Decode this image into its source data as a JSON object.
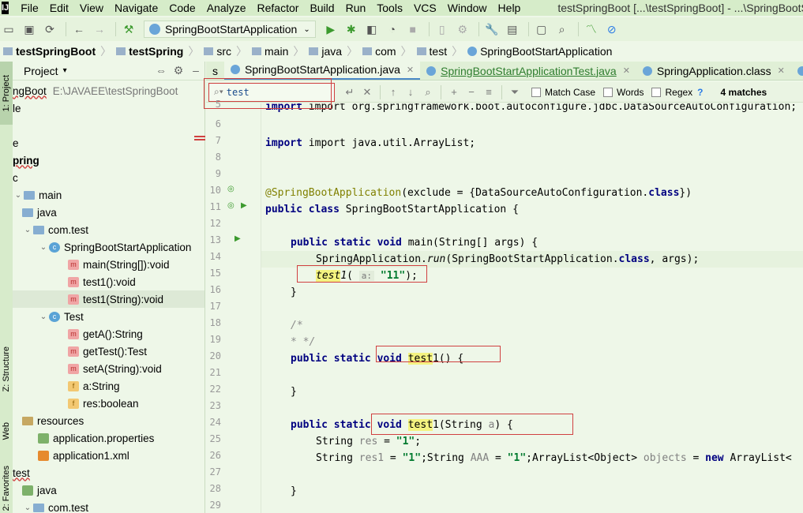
{
  "app": {
    "logo": "IJ",
    "window_title": "testSpringBoot [...\\testSpringBoot] - ...\\SpringBootStartA",
    "menus": [
      "File",
      "Edit",
      "View",
      "Navigate",
      "Code",
      "Analyze",
      "Refactor",
      "Build",
      "Run",
      "Tools",
      "VCS",
      "Window",
      "Help"
    ]
  },
  "toolbar": {
    "run_config": "SpringBootStartApplication"
  },
  "breadcrumb": [
    "testSpringBoot",
    "testSpring",
    "src",
    "main",
    "java",
    "com",
    "test",
    "SpringBootStartApplication"
  ],
  "left_stripe": {
    "project_tab": "1: Project",
    "structure_tab": "Z: Structure",
    "web_tab": "Web",
    "favorites_tab": "2: Favorites"
  },
  "project_panel": {
    "title": "Project",
    "rows": [
      {
        "text": "ngBoot",
        "extra": "E:\\JAVAEE\\testSpringBoot"
      },
      {
        "text": "le"
      },
      {
        "text": "e"
      },
      {
        "text": "pring"
      },
      {
        "text": "c"
      },
      {
        "text": "main"
      },
      {
        "text": "java"
      },
      {
        "text": "com.test"
      },
      {
        "text": "SpringBootStartApplication"
      },
      {
        "text": "main(String[]):void"
      },
      {
        "text": "test1():void"
      },
      {
        "text": "test1(String):void"
      },
      {
        "text": "Test"
      },
      {
        "text": "getA():String"
      },
      {
        "text": "getTest():Test"
      },
      {
        "text": "setA(String):void"
      },
      {
        "text": "a:String"
      },
      {
        "text": "res:boolean"
      },
      {
        "text": "resources"
      },
      {
        "text": "application.properties"
      },
      {
        "text": "application1.xml"
      },
      {
        "text": "test"
      },
      {
        "text": "java"
      },
      {
        "text": "com.test"
      }
    ]
  },
  "editor_tabs": [
    "s",
    "SpringBootStartApplication.java",
    "SpringBootStartApplicationTest.java",
    "SpringApplication.class"
  ],
  "search": {
    "value": "test",
    "match_case": "Match Case",
    "words": "Words",
    "regex": "Regex",
    "help": "?",
    "matches": "4 matches"
  },
  "code": {
    "line_numbers": [
      "5",
      "6",
      "7",
      "8",
      "9",
      "10",
      "11",
      "12",
      "13",
      "14",
      "15",
      "16",
      "17",
      "18",
      "19",
      "20",
      "21",
      "22",
      "23",
      "24",
      "25",
      "26",
      "27",
      "28",
      "29"
    ],
    "l5": "import org.springframework.boot.autoconfigure.jdbc.DataSourceAutoConfiguration;",
    "l7": "import java.util.ArrayList;",
    "l10_ann": "@SpringBootApplication",
    "l10_rest": "(exclude = {DataSourceAutoConfiguration.",
    "l10_kw": "class",
    "l10_end": "})",
    "l11_kw": "public class",
    "l11_rest": " SpringBootStartApplication {",
    "l13_kw": "public static void",
    "l13_rest": " main(String[] args) {",
    "l14_a": "SpringApplication.",
    "l14_b": "run",
    "l14_c": "(SpringBootStartApplication.",
    "l14_kw": "class",
    "l14_d": ", args);",
    "l15_hl": "test",
    "l15_a": "1",
    "l15_b": "( ",
    "l15_hint": "a:",
    "l15_str": "\"11\"",
    "l15_c": ");",
    "l16": "}",
    "l18": "/*",
    "l19": "* */",
    "l20_kw1": "public static",
    "l20_kw2": "void",
    "l20_hl": "test",
    "l20_a": "1",
    "l20_b": "() {",
    "l22": "}",
    "l24_kw1": "public static",
    "l24_kw2": "void",
    "l24_hl": "test",
    "l24_a": "1(String ",
    "l24_p": "a",
    "l24_b": ") {",
    "l25_a": "String ",
    "l25_u": "res",
    "l25_b": " = ",
    "l25_str": "\"1\"",
    "l25_c": ";",
    "l26_a": "String ",
    "l26_u": "res1",
    "l26_b": " = ",
    "l26_s1": "\"1\"",
    "l26_c": ";String ",
    "l26_u2": "AAA",
    "l26_d": " = ",
    "l26_s2": "\"1\"",
    "l26_e": ";ArrayList<Object> ",
    "l26_u3": "objects",
    "l26_f": " = ",
    "l26_kw": "new",
    "l26_g": " ArrayList<",
    "l28": "}"
  }
}
